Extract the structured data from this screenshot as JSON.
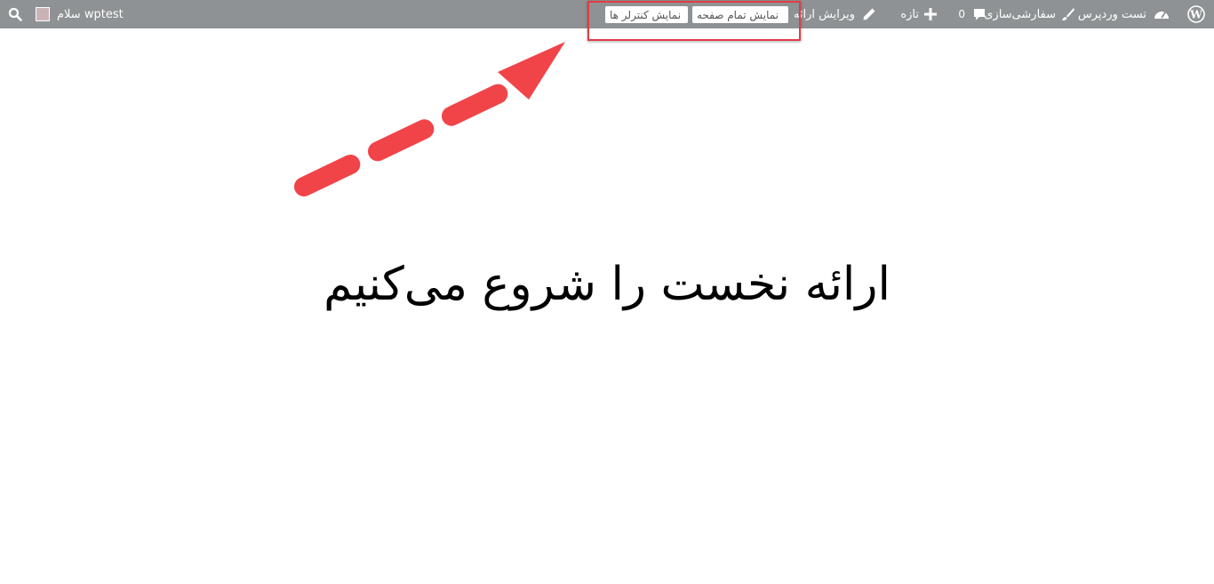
{
  "admin_bar": {
    "background": "#8e9294",
    "wp_logo_icon": "wordpress-logo-icon",
    "site_name": "تست وردپرس",
    "site_icon": "dashboard-icon",
    "customize": "سفارشی‌سازی",
    "customize_icon": "paintbrush-icon",
    "comments_count": "0",
    "comments_icon": "comment-bubble-icon",
    "new_content": "تازه",
    "new_icon": "plus-icon",
    "edit_presentation": "ویرایش ارائه",
    "edit_icon": "pencil-icon",
    "buttons": {
      "fullscreen": "نمایش تمام صفحه",
      "show_controls": "نمایش کنترلر ها"
    },
    "greeting": "سلام wptest",
    "avatar_icon": "avatar",
    "search_icon": "search-icon"
  },
  "annotation": {
    "highlight_color": "#e23c44",
    "arrow_color": "#f04449",
    "arrow_icon": "dashed-arrow-icon"
  },
  "slide": {
    "title": "ارائه نخست را شروع می‌کنیم"
  }
}
